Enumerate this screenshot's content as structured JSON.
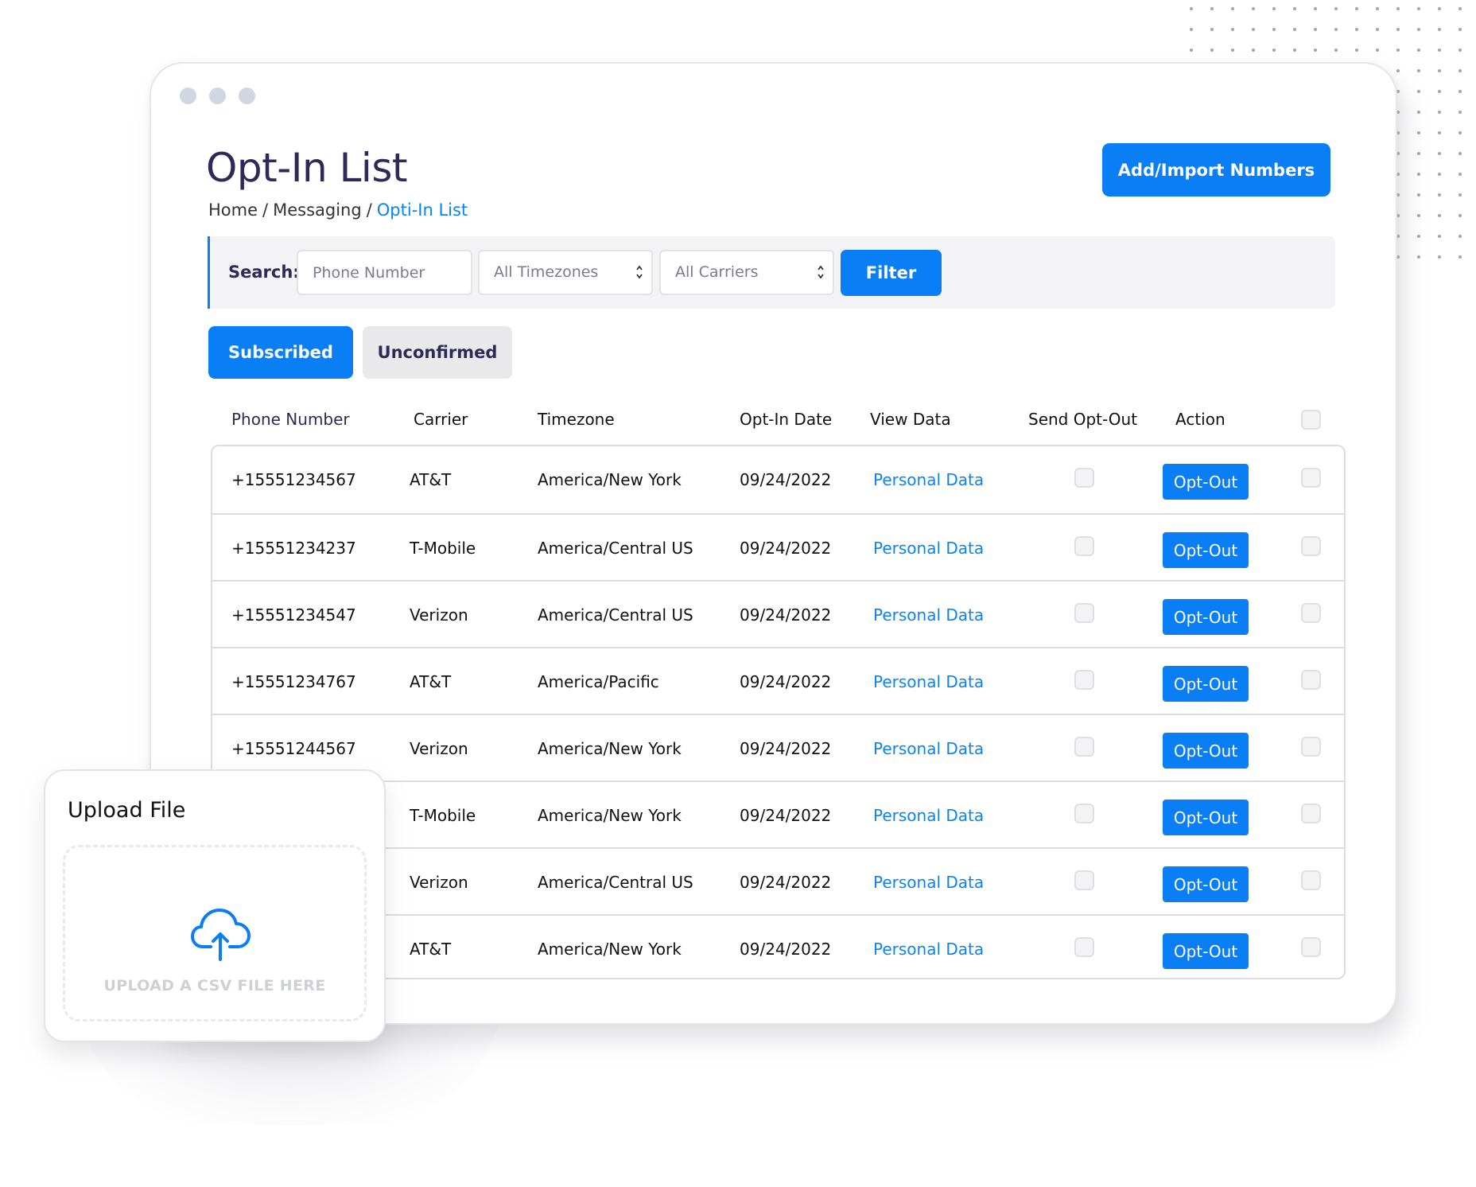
{
  "window": {
    "title": "Opt-In List",
    "breadcrumb": [
      "Home",
      "Messaging",
      "Opti-In List"
    ],
    "breadcrumb_separator": "/",
    "add_import_button": "Add/Import Numbers"
  },
  "search": {
    "label": "Search:",
    "phone_placeholder": "Phone Number",
    "timezone_select": "All Timezones",
    "carrier_select": "All Carriers",
    "filter_button": "Filter"
  },
  "tabs": [
    {
      "label": "Subscribed",
      "active": true
    },
    {
      "label": "Unconfirmed",
      "active": false
    }
  ],
  "table": {
    "columns": [
      "Phone Number",
      "Carrier",
      "Timezone",
      "Opt-In Date",
      "View Data",
      "Send Opt-Out",
      "Action"
    ],
    "rows": [
      {
        "phone": "+15551234567",
        "carrier": "AT&T",
        "timezone": "America/New York",
        "date": "09/24/2022",
        "view": "Personal Data",
        "action": "Opt-Out"
      },
      {
        "phone": "+15551234237",
        "carrier": "T-Mobile",
        "timezone": "America/Central US",
        "date": "09/24/2022",
        "view": "Personal Data",
        "action": "Opt-Out"
      },
      {
        "phone": "+15551234547",
        "carrier": "Verizon",
        "timezone": "America/Central US",
        "date": "09/24/2022",
        "view": "Personal Data",
        "action": "Opt-Out"
      },
      {
        "phone": "+15551234767",
        "carrier": "AT&T",
        "timezone": "America/Pacific",
        "date": "09/24/2022",
        "view": "Personal Data",
        "action": "Opt-Out"
      },
      {
        "phone": "+15551244567",
        "carrier": "Verizon",
        "timezone": "America/New York",
        "date": "09/24/2022",
        "view": "Personal Data",
        "action": "Opt-Out"
      },
      {
        "phone": "",
        "carrier": "T-Mobile",
        "timezone": "America/New York",
        "date": "09/24/2022",
        "view": "Personal Data",
        "action": "Opt-Out"
      },
      {
        "phone": "",
        "carrier": "Verizon",
        "timezone": "America/Central US",
        "date": "09/24/2022",
        "view": "Personal Data",
        "action": "Opt-Out"
      },
      {
        "phone": "",
        "carrier": "AT&T",
        "timezone": "America/New York",
        "date": "09/24/2022",
        "view": "Personal Data",
        "action": "Opt-Out"
      }
    ]
  },
  "upload": {
    "title": "Upload File",
    "hint": "UPLOAD A CSV FILE HERE",
    "icon": "cloud-upload-icon"
  },
  "colors": {
    "accent": "#0a7ff5",
    "title": "#2e2a58",
    "link": "#0a84f5"
  }
}
